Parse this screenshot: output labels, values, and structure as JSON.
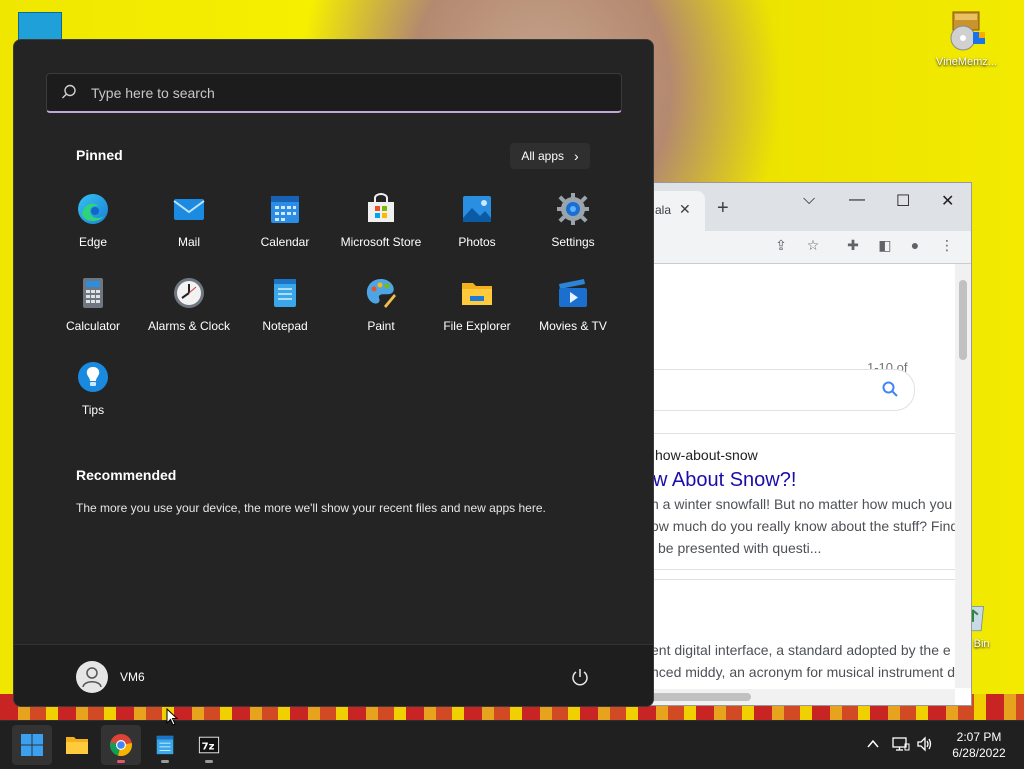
{
  "desktop": {
    "icons": [
      {
        "label": "VineMemz..."
      },
      {
        "label": "cle Bin"
      }
    ]
  },
  "start_menu": {
    "search": {
      "placeholder": "Type here to search"
    },
    "pinned": {
      "title": "Pinned",
      "all_apps_label": "All apps",
      "apps": [
        {
          "label": "Edge",
          "icon": "edge-icon"
        },
        {
          "label": "Mail",
          "icon": "mail-icon"
        },
        {
          "label": "Calendar",
          "icon": "calendar-icon"
        },
        {
          "label": "Microsoft Store",
          "icon": "store-icon"
        },
        {
          "label": "Photos",
          "icon": "photos-icon"
        },
        {
          "label": "Settings",
          "icon": "settings-icon"
        },
        {
          "label": "Calculator",
          "icon": "calculator-icon"
        },
        {
          "label": "Alarms & Clock",
          "icon": "clock-icon"
        },
        {
          "label": "Notepad",
          "icon": "notepad-icon"
        },
        {
          "label": "Paint",
          "icon": "paint-icon"
        },
        {
          "label": "File Explorer",
          "icon": "folder-icon"
        },
        {
          "label": "Movies & TV",
          "icon": "movies-icon"
        },
        {
          "label": "Tips",
          "icon": "tips-icon"
        }
      ]
    },
    "recommended": {
      "title": "Recommended",
      "text": "The more you use your device, the more we'll show your recent files and new apps here."
    },
    "user": {
      "name": "VM6"
    }
  },
  "browser": {
    "tab_title": "ala",
    "result_count": "1-10 of",
    "result": {
      "url": "how-about-snow",
      "title": "w About Snow?!",
      "snippet_lines": [
        "n a winter snowfall! But no matter how much you",
        "ow much do you really know about the stuff? Find",
        "l be presented with questi..."
      ]
    },
    "result2": {
      "snippet_lines": [
        "ent digital interface, a standard adopted by the e",
        "nced middy, an acronym for musical instrument d"
      ]
    }
  },
  "taskbar": {
    "clock": {
      "time": "2:07 PM",
      "date": "6/28/2022"
    }
  }
}
